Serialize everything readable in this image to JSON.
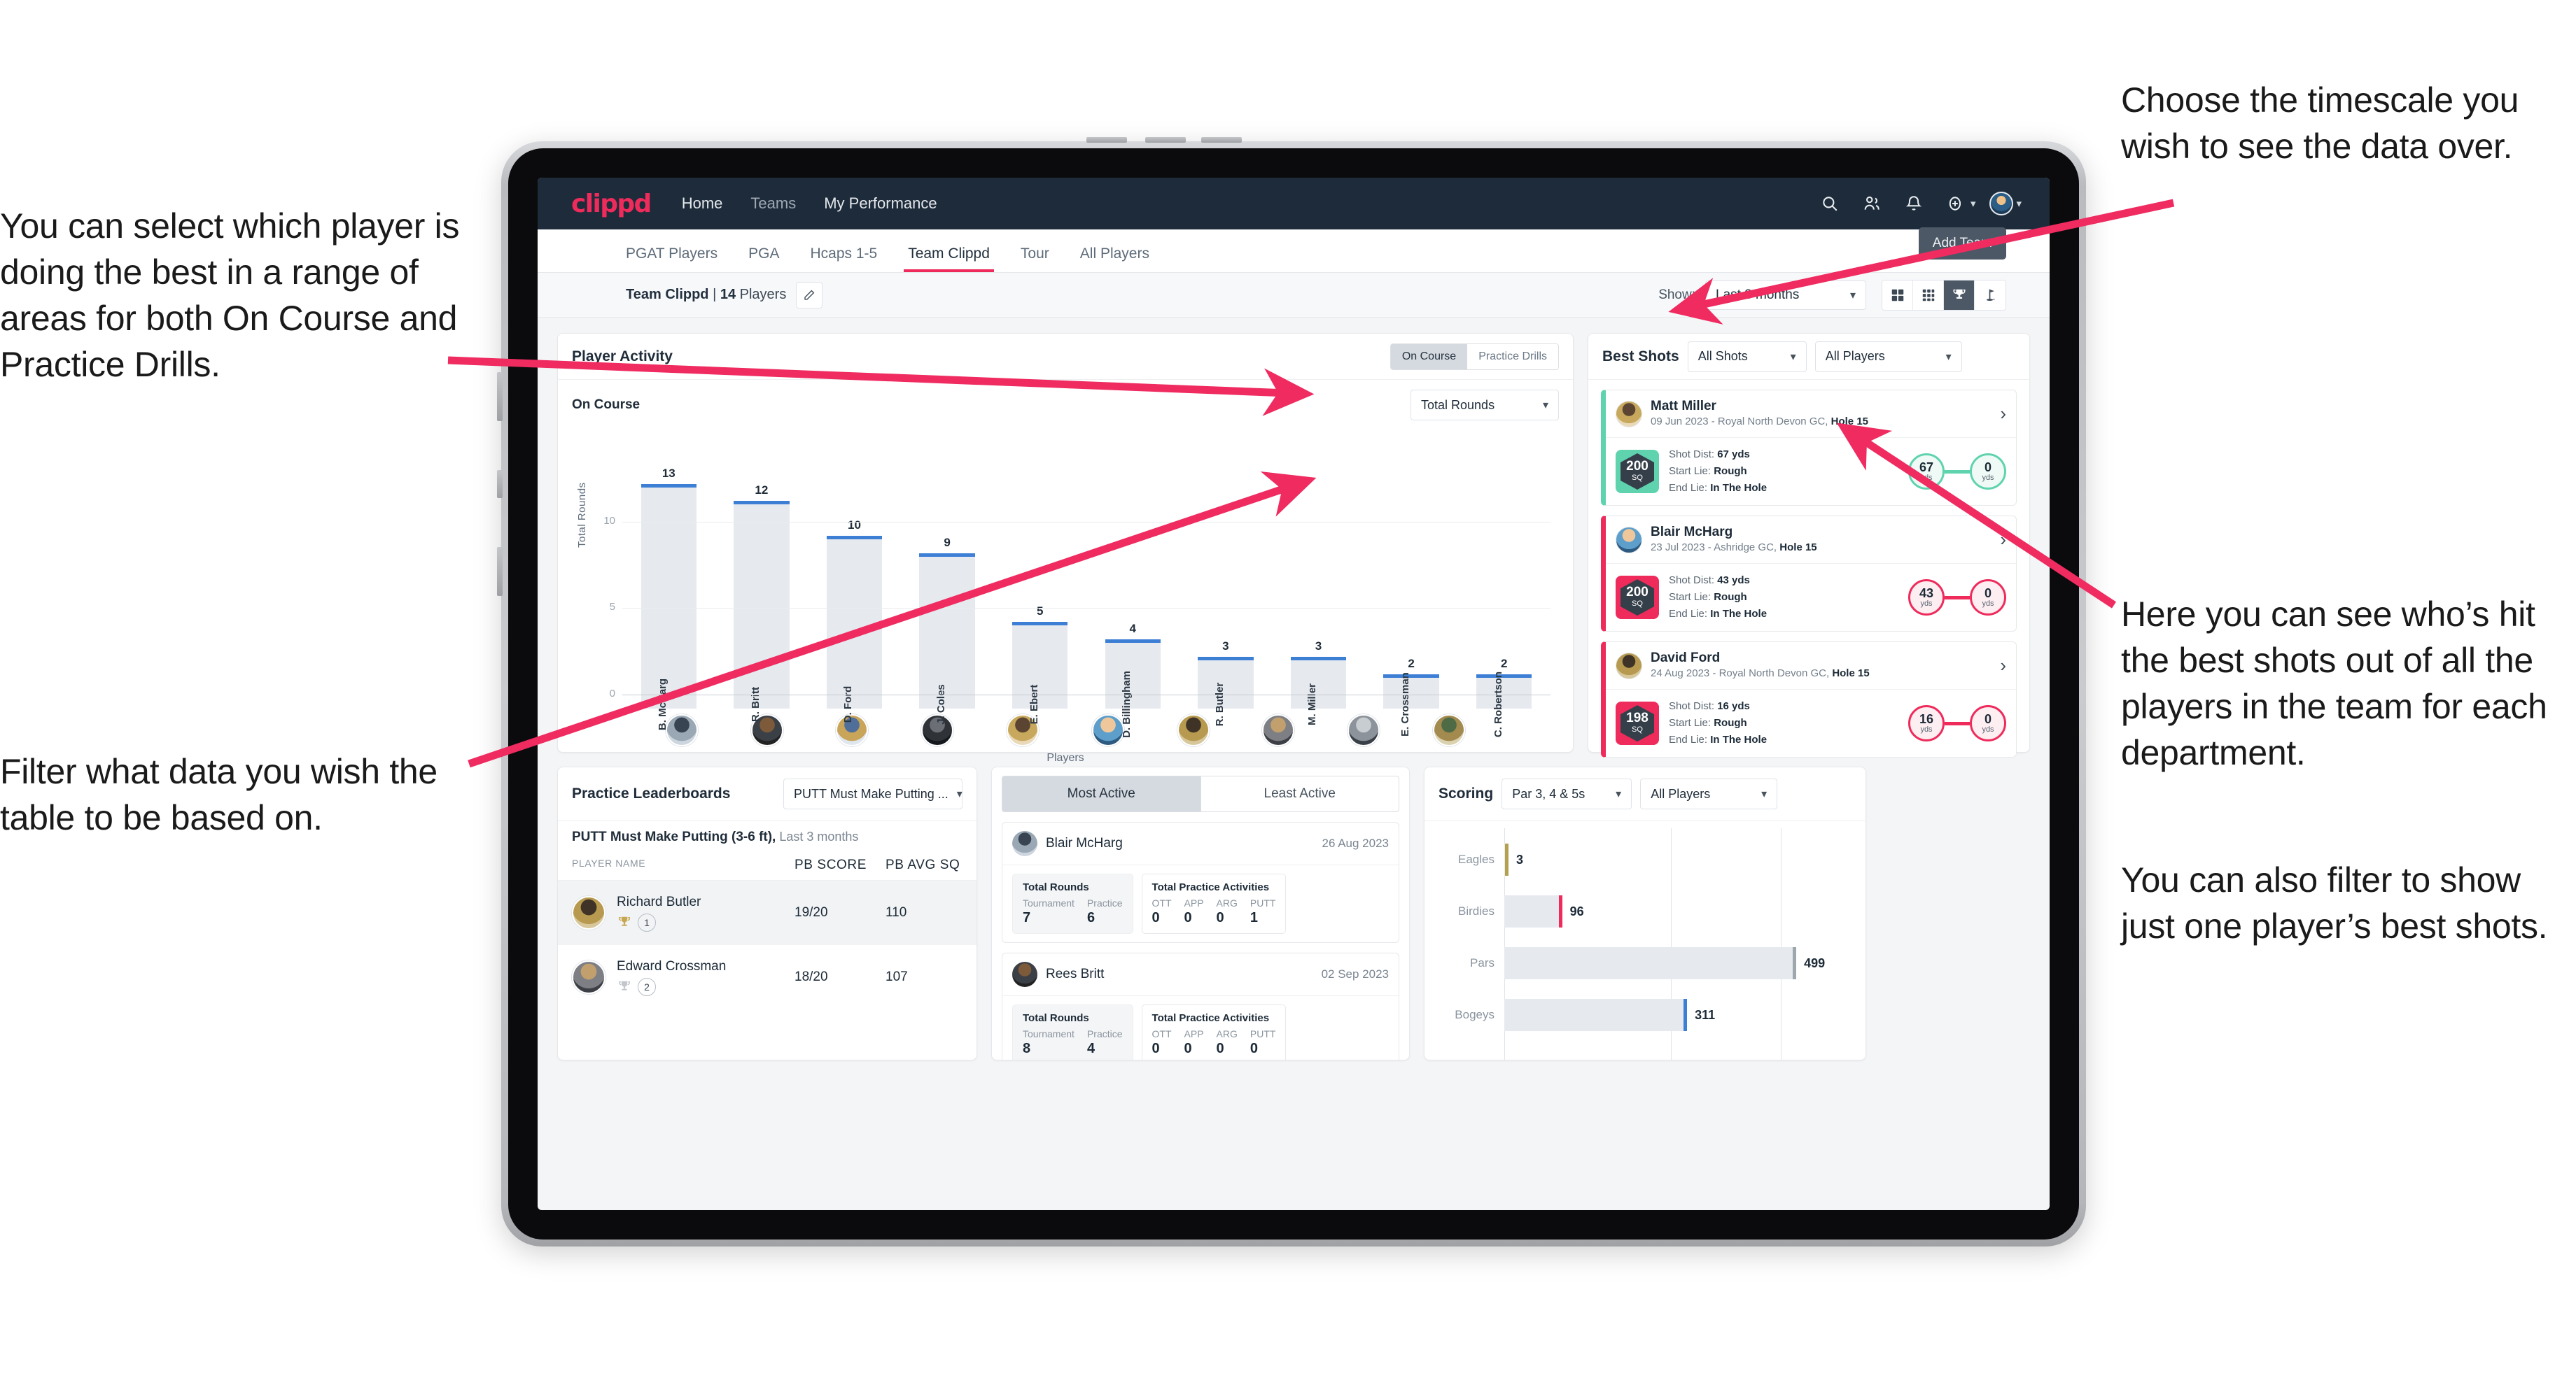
{
  "annotations": {
    "left_top": "You can select which player is doing the best in a range of areas for both On Course and Practice Drills.",
    "left_bottom": "Filter what data you wish the table to be based on.",
    "right_top": "Choose the timescale you wish to see the data over.",
    "right_middle": "Here you can see who’s hit the best shots out of all the players in the team for each department.",
    "right_bottom": "You can also filter to show just one player’s best shots."
  },
  "topnav": {
    "logo": "clippd",
    "links": [
      {
        "label": "Home",
        "active": true
      },
      {
        "label": "Teams",
        "active": false
      },
      {
        "label": "My Performance",
        "active": true
      }
    ],
    "icons": [
      "search-icon",
      "people-icon",
      "bell-icon",
      "add-circle-icon",
      "avatar-icon"
    ]
  },
  "tabs": {
    "items": [
      {
        "label": "PGAT Players",
        "active": false
      },
      {
        "label": "PGA",
        "active": false
      },
      {
        "label": "Hcaps 1-5",
        "active": false
      },
      {
        "label": "Team Clippd",
        "active": true
      },
      {
        "label": "Tour",
        "active": false
      },
      {
        "label": "All Players",
        "active": false
      }
    ],
    "add_team_button": "Add Team"
  },
  "toolbar": {
    "team_name": "Team Clippd",
    "team_separator": " | ",
    "player_count": "14",
    "players_word": " Players",
    "edit_icon": "pencil-icon",
    "show_label": "Show:",
    "show_value": "Last 3 months",
    "view_toggles": [
      {
        "icon": "grid-2x2-icon",
        "active": false
      },
      {
        "icon": "grid-3x3-icon",
        "active": false
      },
      {
        "icon": "trophy-icon",
        "active": true
      },
      {
        "icon": "flag-icon",
        "active": false
      }
    ]
  },
  "player_activity": {
    "title": "Player Activity",
    "segments": [
      {
        "label": "On Course",
        "active": true
      },
      {
        "label": "Practice Drills",
        "active": false
      }
    ],
    "sub_label": "On Course",
    "metric_select": "Total Rounds"
  },
  "chart_data": {
    "type": "bar",
    "title": "Player Activity - On Course",
    "xlabel": "Players",
    "ylabel": "Total Rounds",
    "ylim": [
      0,
      14
    ],
    "yticks": [
      0,
      5,
      10
    ],
    "grid": true,
    "categories": [
      "B. McHarg",
      "R. Britt",
      "D. Ford",
      "J. Coles",
      "E. Ebert",
      "D. Billingham",
      "R. Butler",
      "M. Miller",
      "E. Crossman",
      "C. Robertson"
    ],
    "values": [
      13,
      12,
      10,
      9,
      5,
      4,
      3,
      3,
      2,
      2
    ],
    "bar_color": "#e6e9ee",
    "cap_color": "#3e7fd6"
  },
  "best_shots": {
    "title": "Best Shots",
    "shot_filter": "All Shots",
    "player_filter": "All Players",
    "items": [
      {
        "player": "Matt Miller",
        "meta_date": "09 Jun 2023 - Royal North Devon GC,",
        "meta_hole": "Hole 15",
        "sq": "200",
        "sq_unit": "SQ",
        "accent": "#5fd3ae",
        "shot_dist_label": "Shot Dist:",
        "shot_dist": "67 yds",
        "start_lie_label": "Start Lie:",
        "start_lie": "Rough",
        "end_lie_label": "End Lie:",
        "end_lie": "In The Hole",
        "from_value": "67",
        "from_unit": "yds",
        "to_value": "0",
        "to_unit": "yds"
      },
      {
        "player": "Blair McHarg",
        "meta_date": "23 Jul 2023 - Ashridge GC,",
        "meta_hole": "Hole 15",
        "sq": "200",
        "sq_unit": "SQ",
        "accent": "#ee2b5b",
        "shot_dist_label": "Shot Dist:",
        "shot_dist": "43 yds",
        "start_lie_label": "Start Lie:",
        "start_lie": "Rough",
        "end_lie_label": "End Lie:",
        "end_lie": "In The Hole",
        "from_value": "43",
        "from_unit": "yds",
        "to_value": "0",
        "to_unit": "yds"
      },
      {
        "player": "David Ford",
        "meta_date": "24 Aug 2023 - Royal North Devon GC,",
        "meta_hole": "Hole 15",
        "sq": "198",
        "sq_unit": "SQ",
        "accent": "#ee2b5b",
        "shot_dist_label": "Shot Dist:",
        "shot_dist": "16 yds",
        "start_lie_label": "Start Lie:",
        "start_lie": "Rough",
        "end_lie_label": "End Lie:",
        "end_lie": "In The Hole",
        "from_value": "16",
        "from_unit": "yds",
        "to_value": "0",
        "to_unit": "yds"
      }
    ]
  },
  "practice_leaderboards": {
    "title": "Practice Leaderboards",
    "drill_select": "PUTT Must Make Putting ...",
    "subtitle_bold": "PUTT Must Make Putting (3-6 ft),",
    "subtitle_rest": " Last 3 months",
    "columns": [
      "PLAYER NAME",
      "PB SCORE",
      "PB AVG SQ"
    ],
    "rows": [
      {
        "name": "Richard Butler",
        "rank": "1",
        "trophy": "gold",
        "pb_score": "19/20",
        "pb_avg_sq": "110",
        "highlighted": true
      },
      {
        "name": "Edward Crossman",
        "rank": "2",
        "trophy": "silver",
        "pb_score": "18/20",
        "pb_avg_sq": "107",
        "highlighted": false
      }
    ]
  },
  "activity": {
    "tabs": [
      {
        "label": "Most Active",
        "active": true
      },
      {
        "label": "Least Active",
        "active": false
      }
    ],
    "rounds_title": "Total Rounds",
    "rounds_cols": [
      "Tournament",
      "Practice"
    ],
    "practice_title": "Total Practice Activities",
    "practice_cols": [
      "OTT",
      "APP",
      "ARG",
      "PUTT"
    ],
    "cards": [
      {
        "name": "Blair McHarg",
        "date": "26 Aug 2023",
        "rounds": [
          "7",
          "6"
        ],
        "practice": [
          "0",
          "0",
          "0",
          "1"
        ]
      },
      {
        "name": "Rees Britt",
        "date": "02 Sep 2023",
        "rounds": [
          "8",
          "4"
        ],
        "practice": [
          "0",
          "0",
          "0",
          "0"
        ]
      }
    ]
  },
  "scoring": {
    "title": "Scoring",
    "par_select": "Par 3, 4 & 5s",
    "player_select": "All Players",
    "chart": {
      "type": "bar",
      "orientation": "horizontal",
      "categories": [
        "Eagles",
        "Birdies",
        "Pars",
        "Bogeys"
      ],
      "values": [
        3,
        96,
        499,
        311
      ],
      "max": 600,
      "cap_colors": [
        "#b5a04e",
        "#ee2b5b",
        "#9ea6ae",
        "#3e7fd6"
      ]
    }
  }
}
